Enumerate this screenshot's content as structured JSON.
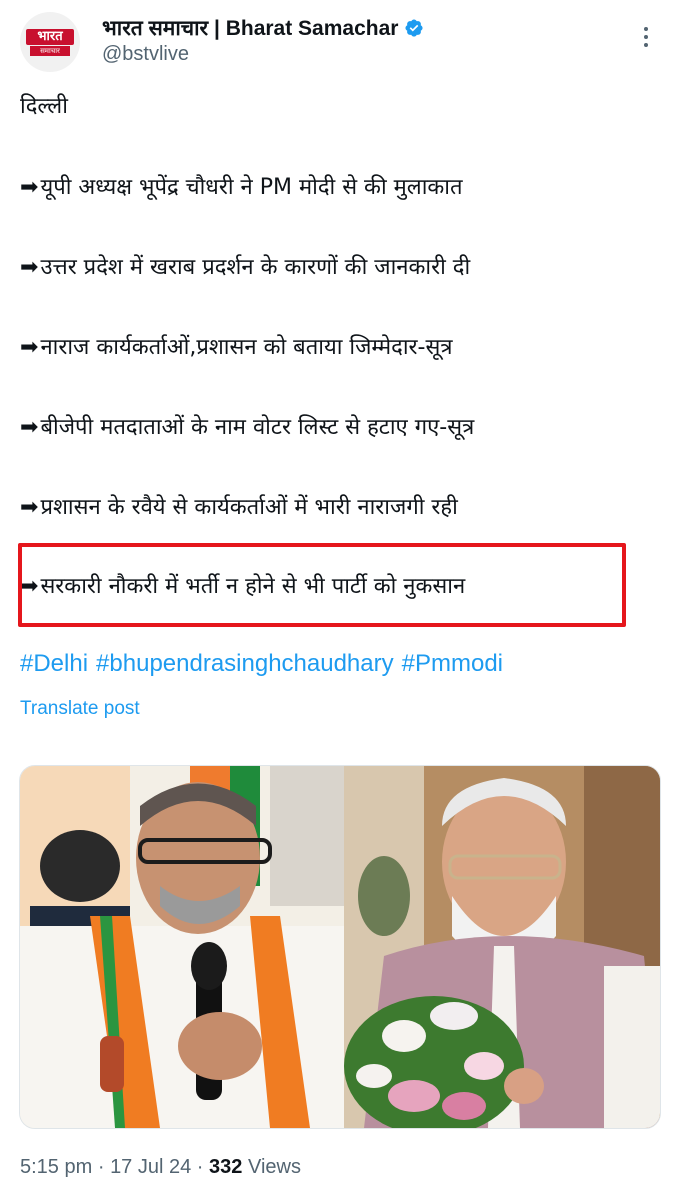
{
  "author": {
    "display_name": "भारत समाचार | Bharat Samachar",
    "handle": "@bstvlive",
    "avatar_logo_top": "भारत",
    "avatar_logo_bottom": "समाचार",
    "verified": true
  },
  "post": {
    "location": "दिल्ली",
    "bullet_glyph": "➡",
    "points": [
      "यूपी अध्यक्ष भूपेंद्र चौधरी ने PM मोदी से की मुलाकात",
      "उत्तर प्रदेश में खराब प्रदर्शन के कारणों की जानकारी दी",
      "नाराज कार्यकर्ताओं,प्रशासन को बताया जिम्मेदार-सूत्र",
      "बीजेपी मतदाताओं के नाम वोटर लिस्ट से हटाए गए-सूत्र",
      "प्रशासन के रवैये से कार्यकर्ताओं में भारी नाराजगी रही",
      "सरकारी नौकरी में भर्ती न होने से भी पार्टी को नुकसान"
    ],
    "hashtags": [
      "#Delhi",
      "#bhupendrasinghchaudhary",
      "#Pmmodi"
    ],
    "translate_label": "Translate post"
  },
  "meta": {
    "time": "5:15 pm",
    "separator": "·",
    "date": "17 Jul 24",
    "views_count": "332",
    "views_label": "Views"
  },
  "colors": {
    "link": "#1d9bf0",
    "highlight_border": "#e5161c",
    "text_primary": "#0f1419",
    "text_secondary": "#536471",
    "verified": "#1d9bf0",
    "logo_red": "#c8102e"
  },
  "icons": [
    "verified-badge-icon",
    "more-options-icon",
    "arrow-right-icon"
  ]
}
